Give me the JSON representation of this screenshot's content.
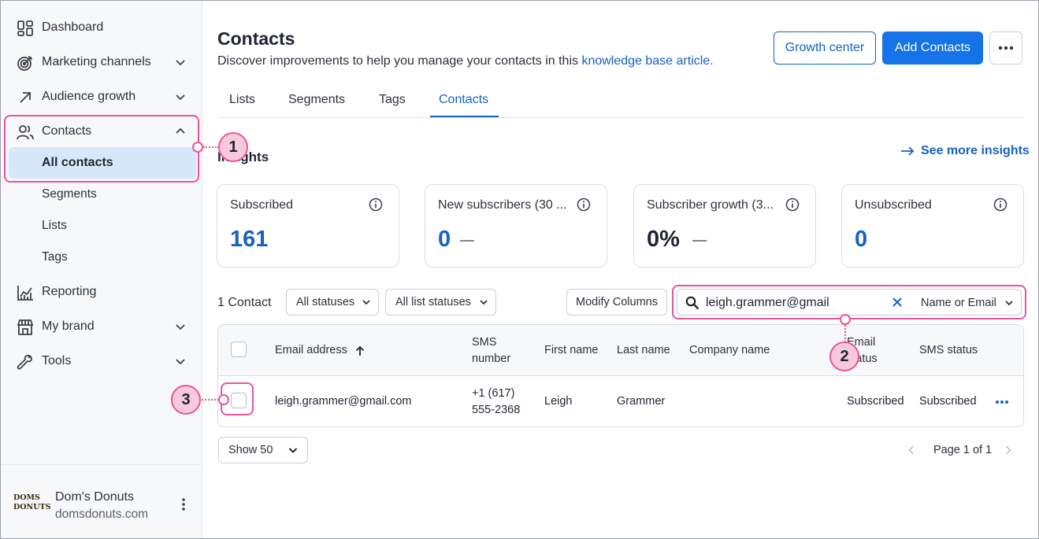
{
  "sidebar": {
    "items": [
      {
        "label": "Dashboard",
        "icon": "dashboard-icon"
      },
      {
        "label": "Marketing channels",
        "icon": "target-icon"
      },
      {
        "label": "Audience growth",
        "icon": "arrow-up-right-icon"
      },
      {
        "label": "Contacts",
        "icon": "users-icon"
      },
      {
        "label": "Reporting",
        "icon": "chart-icon"
      },
      {
        "label": "My brand",
        "icon": "store-icon"
      },
      {
        "label": "Tools",
        "icon": "wrench-icon"
      }
    ],
    "contacts_sub": [
      "All contacts",
      "Segments",
      "Lists",
      "Tags"
    ],
    "brand": {
      "name": "Dom's Donuts",
      "url": "domsdonuts.com",
      "logo_line1": "DOMS",
      "logo_line2": "DONUTS"
    }
  },
  "header": {
    "title": "Contacts",
    "subtitle": "Discover improvements to help you manage your contacts in this ",
    "link_text": "knowledge base article.",
    "growth_center": "Growth center",
    "add_contacts": "Add Contacts"
  },
  "tabs": [
    "Lists",
    "Segments",
    "Tags",
    "Contacts"
  ],
  "insights": {
    "title": "Insights",
    "see_more": "See more insights",
    "cards": [
      {
        "title": "Subscribed",
        "value": "161"
      },
      {
        "title": "New subscribers (30 ...",
        "value": "0"
      },
      {
        "title": "Subscriber growth (3...",
        "value": "0%"
      },
      {
        "title": "Unsubscribed",
        "value": "0"
      }
    ]
  },
  "toolbar": {
    "count": "1 Contact",
    "all_statuses": "All statuses",
    "all_list_statuses": "All list statuses",
    "modify_columns": "Modify Columns",
    "search_value": "leigh.grammer@gmail",
    "search_type": "Name or Email"
  },
  "table": {
    "headers": {
      "email": "Email address",
      "sms_1": "SMS",
      "sms_2": "number",
      "first": "First name",
      "last": "Last name",
      "company": "Company name",
      "email_status_1": "Email",
      "email_status_2": "status",
      "sms_status": "SMS status"
    },
    "rows": [
      {
        "email": "leigh.grammer@gmail.com",
        "sms_1": "+1 (617)",
        "sms_2": "555-2368",
        "first": "Leigh",
        "last": "Grammer",
        "company": "",
        "email_status": "Subscribed",
        "sms_status": "Subscribed"
      }
    ]
  },
  "footer": {
    "show": "Show 50",
    "page": "Page 1 of 1"
  },
  "annotations": [
    "1",
    "2",
    "3"
  ],
  "colors": {
    "accent": "#1561c4",
    "primary_button": "#1473e6",
    "highlight": "#e9559a",
    "badge_fill": "#f6c9dc",
    "selected_nav": "#d7e8fb"
  }
}
